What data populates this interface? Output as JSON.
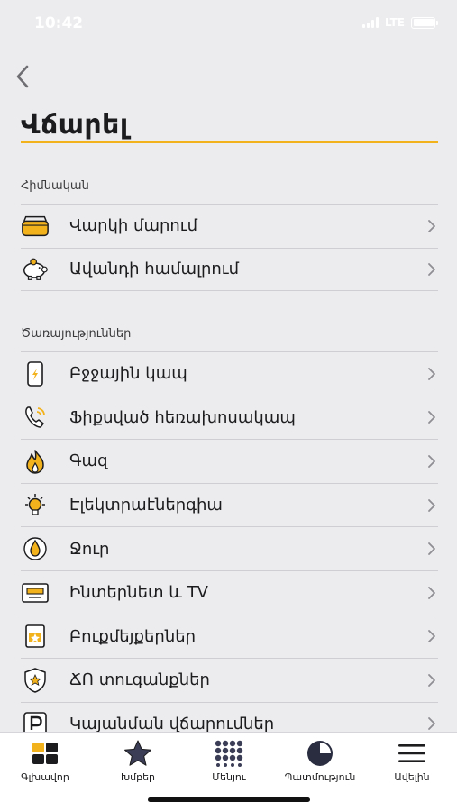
{
  "status": {
    "time": "10:42",
    "network": "LTE"
  },
  "page": {
    "title": "Վճարել"
  },
  "sections": {
    "basic": {
      "header": "Հիմնական",
      "items": [
        {
          "label": "Վարկի մարում",
          "icon": "wallet-icon"
        },
        {
          "label": "Ավանդի համալրում",
          "icon": "piggy-bank-icon"
        }
      ]
    },
    "services": {
      "header": "Ծառայություններ",
      "items": [
        {
          "label": "Բջջային կապ",
          "icon": "mobile-phone-icon"
        },
        {
          "label": "Ֆիքսված հեռախոսակապ",
          "icon": "landline-phone-icon"
        },
        {
          "label": "Գազ",
          "icon": "flame-icon"
        },
        {
          "label": "Էլեկտրաէներգիա",
          "icon": "light-bulb-icon"
        },
        {
          "label": "Ջուր",
          "icon": "water-drop-icon"
        },
        {
          "label": "Ինտերնետ և TV",
          "icon": "router-icon"
        },
        {
          "label": "Բուքմեյքերներ",
          "icon": "ticket-icon"
        },
        {
          "label": "ՃՈ տուգանքներ",
          "icon": "police-badge-icon"
        },
        {
          "label": "Կայանման վճարումներ",
          "icon": "parking-icon"
        }
      ]
    }
  },
  "tabbar": {
    "items": [
      {
        "label": "Գլխավոր",
        "icon": "home-grid-icon"
      },
      {
        "label": "Խմբեր",
        "icon": "star-icon"
      },
      {
        "label": "Մենյու",
        "icon": "menu-dots-icon"
      },
      {
        "label": "Պատմություն",
        "icon": "history-clock-icon"
      },
      {
        "label": "Ավելին",
        "icon": "hamburger-icon"
      }
    ]
  },
  "colors": {
    "accent": "#f2b21c",
    "background": "#ececee",
    "text": "#1c1c1e"
  }
}
